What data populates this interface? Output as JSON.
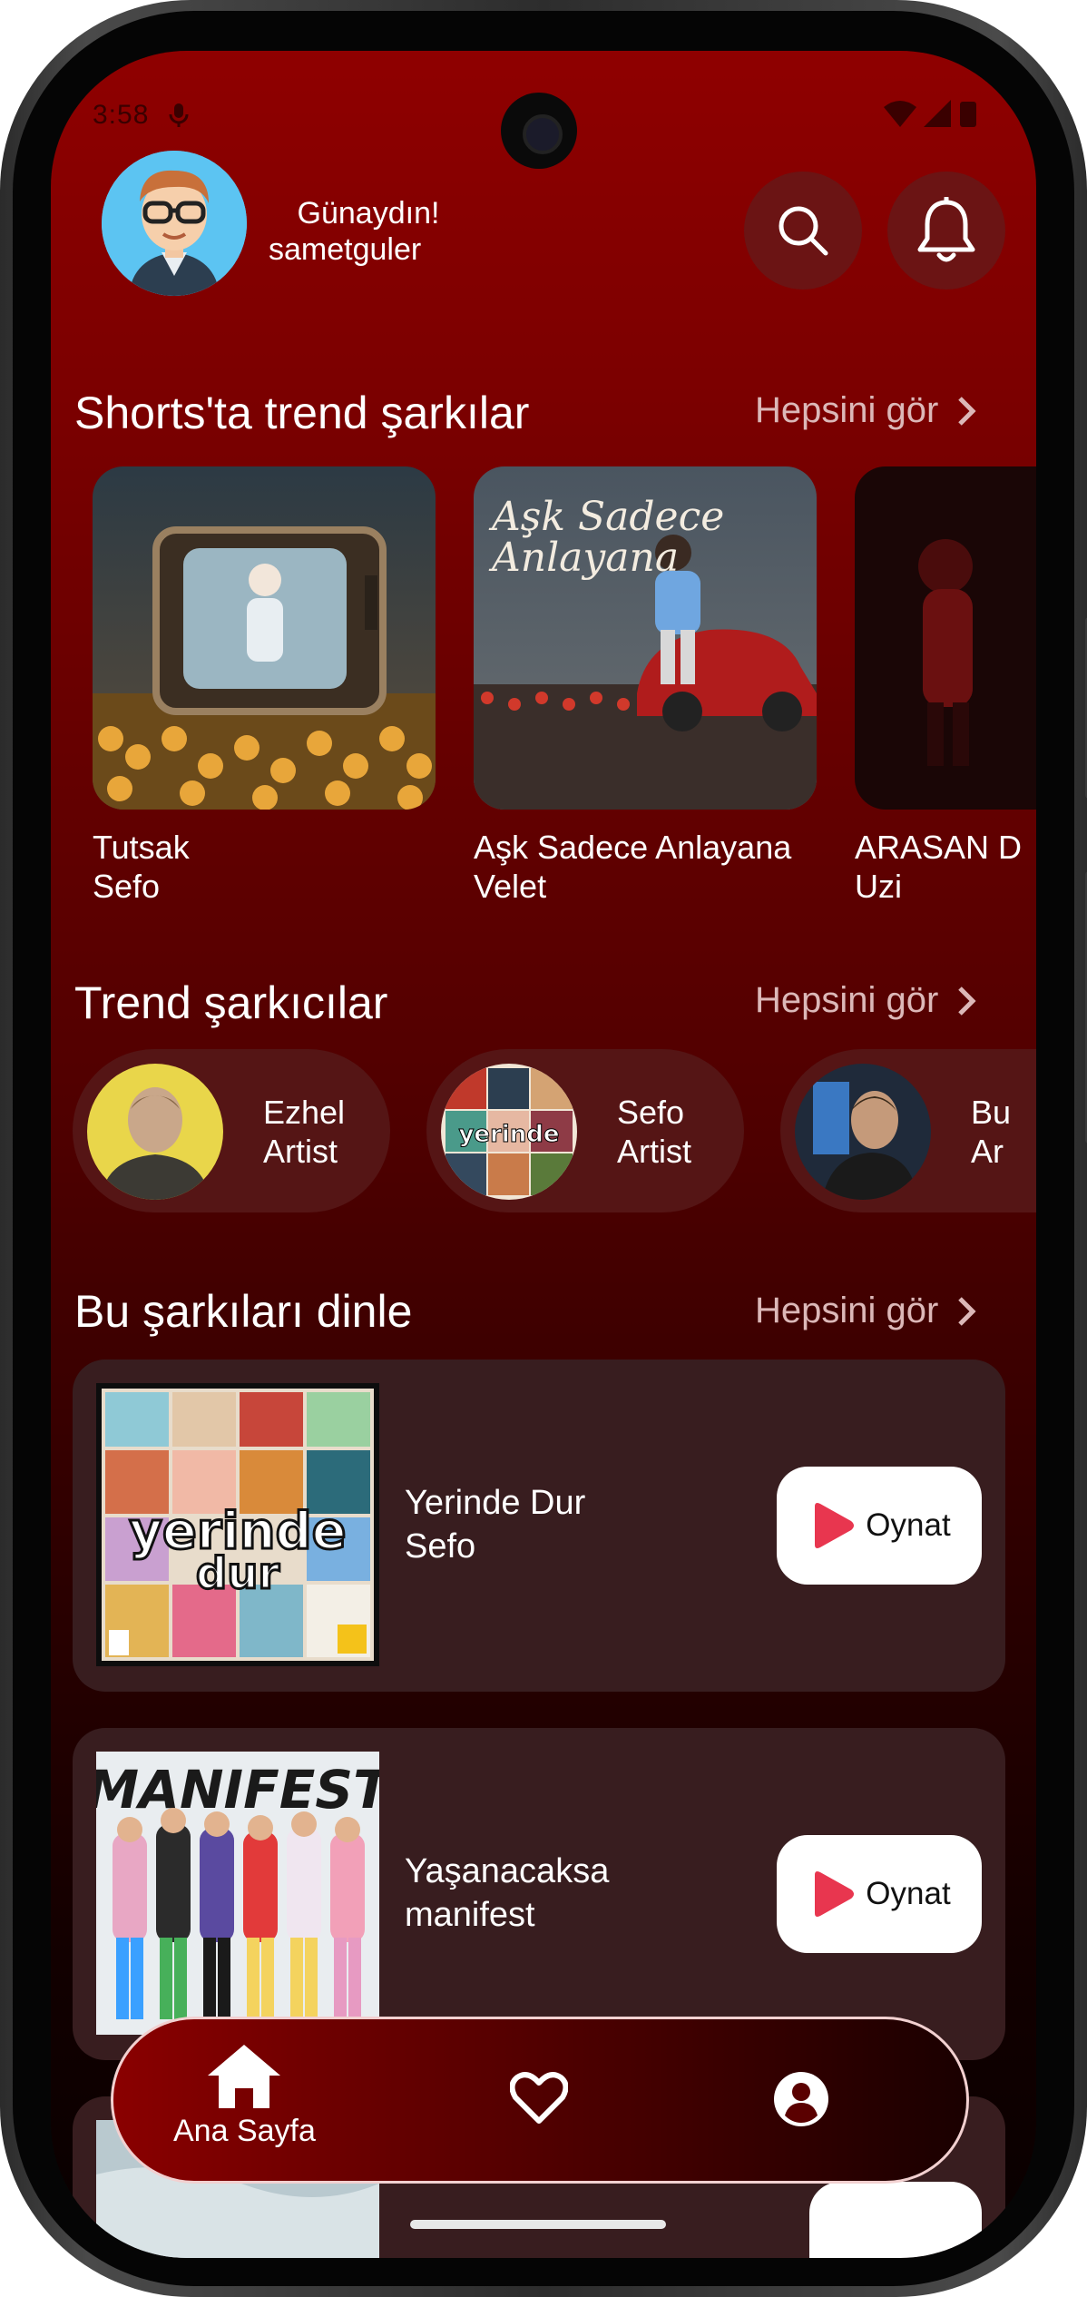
{
  "status_bar": {
    "time": "3:58"
  },
  "header": {
    "greeting": "Günaydın!",
    "username": "sametguler"
  },
  "trending_shorts": {
    "title": "Shorts'ta trend şarkılar",
    "see_all": "Hepsini gör",
    "items": [
      {
        "title": "Tutsak",
        "artist": "Sefo"
      },
      {
        "title": "Aşk Sadece Anlayana",
        "artist": "Velet",
        "cover_text": "Aşk Sadece Anlayana"
      },
      {
        "title": "ARASAN D",
        "artist": "Uzi"
      }
    ]
  },
  "trending_artists": {
    "title": "Trend şarkıcılar",
    "see_all": "Hepsini gör",
    "items": [
      {
        "name": "Ezhel",
        "role": "Artist"
      },
      {
        "name": "Sefo",
        "role": "Artist"
      },
      {
        "name": "Bu",
        "role": "Ar"
      }
    ]
  },
  "listen_songs": {
    "title": "Bu şarkıları dinle",
    "see_all": "Hepsini gör",
    "items": [
      {
        "title": "Yerinde Dur",
        "artist": "Sefo",
        "play_label": "Oynat",
        "cover_text": "yerinde dur"
      },
      {
        "title": "Yaşanacaksa",
        "artist": "manifest",
        "play_label": "Oynat",
        "cover_text": "MANIFEST"
      }
    ]
  },
  "bottom_nav": {
    "items": [
      {
        "label": "Ana Sayfa",
        "icon": "home-icon",
        "active": true
      },
      {
        "label": "",
        "icon": "heart-icon",
        "active": false
      },
      {
        "label": "",
        "icon": "profile-icon",
        "active": false
      }
    ]
  },
  "colors": {
    "background_top": "#8f0000",
    "background_bottom": "#080000",
    "card": "#381d1f",
    "play_icon": "#e8364f"
  }
}
